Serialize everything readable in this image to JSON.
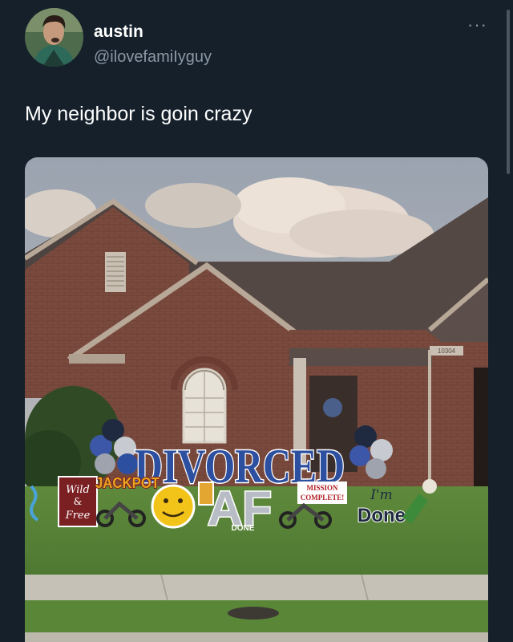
{
  "tweet": {
    "display_name": "austin",
    "handle": "@ilovefamiIyguy",
    "text": "My neighbor is goin crazy",
    "more_icon": "···"
  },
  "photo": {
    "sign_main": "DIVORCED",
    "sign_af": "AF",
    "sign_jackpot": "JACKPOT",
    "sign_wild_1": "Wild",
    "sign_wild_2": "&",
    "sign_wild_3": "Free",
    "sign_mission_1": "MISSION",
    "sign_mission_2": "COMPLETE!",
    "sign_im": "I'm",
    "sign_done": "Done",
    "sign_done_small": "DONE",
    "house_number": "10304"
  },
  "colors": {
    "background": "#15202b",
    "secondary_text": "#8b98a5",
    "sign_blue": "#2d4fa0",
    "sign_silver": "#b8bcc4"
  }
}
